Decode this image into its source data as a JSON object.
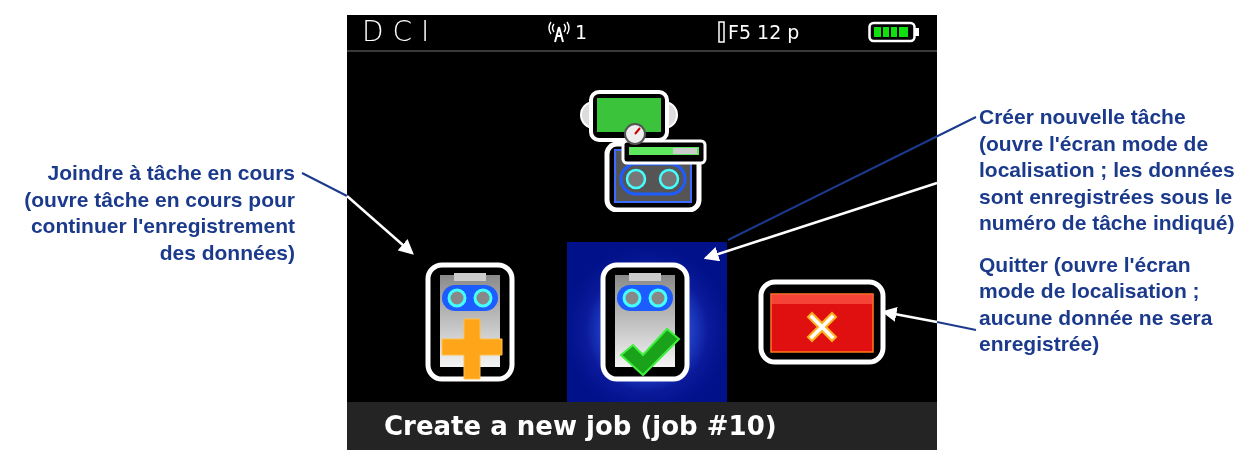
{
  "callouts_left": [
    {
      "text": "Joindre à tâche en cours (ouvre tâche en cours pour continuer l'enregistrement des données)"
    }
  ],
  "screen": {
    "status_bar": {
      "logo": "DCI",
      "channel": "1",
      "frequency": "F5 12 p"
    },
    "options": [
      {
        "kind": "join",
        "selected": false
      },
      {
        "kind": "create",
        "selected": true
      },
      {
        "kind": "quit",
        "selected": false
      }
    ],
    "message": "Create a new job (job #10)"
  },
  "callouts_right": [
    {
      "text": "Créer nouvelle tâche (ouvre l'écran mode de localisation ; les données sont enregistrées sous le numéro de tâche indiqué)"
    },
    {
      "text": "Quitter (ouvre l'écran mode de localisation ; aucune donnée ne sera enregistrée)"
    }
  ]
}
